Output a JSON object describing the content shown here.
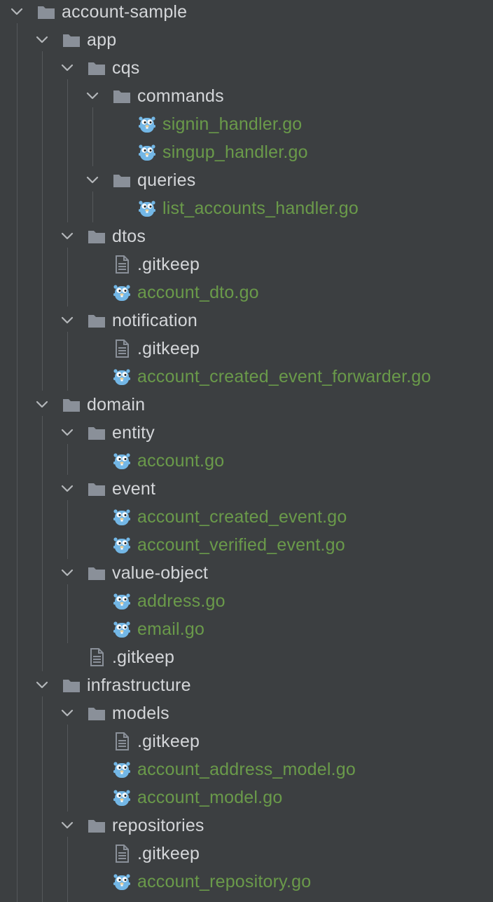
{
  "project_tree": {
    "items": [
      {
        "label": "account-sample",
        "kind": "folder",
        "depth": 0,
        "expanded": true,
        "icon": "folder-icon"
      },
      {
        "label": "app",
        "kind": "folder",
        "depth": 1,
        "expanded": true,
        "icon": "folder-icon"
      },
      {
        "label": "cqs",
        "kind": "folder",
        "depth": 2,
        "expanded": true,
        "icon": "folder-icon"
      },
      {
        "label": "commands",
        "kind": "folder",
        "depth": 3,
        "expanded": true,
        "icon": "folder-icon"
      },
      {
        "label": "signin_handler.go",
        "kind": "go",
        "depth": 4,
        "icon": "go-gopher-icon"
      },
      {
        "label": "singup_handler.go",
        "kind": "go",
        "depth": 4,
        "icon": "go-gopher-icon"
      },
      {
        "label": "queries",
        "kind": "folder",
        "depth": 3,
        "expanded": true,
        "icon": "folder-icon"
      },
      {
        "label": "list_accounts_handler.go",
        "kind": "go",
        "depth": 4,
        "icon": "go-gopher-icon"
      },
      {
        "label": "dtos",
        "kind": "folder",
        "depth": 2,
        "expanded": true,
        "icon": "folder-icon"
      },
      {
        "label": ".gitkeep",
        "kind": "file",
        "depth": 3,
        "icon": "text-file-icon"
      },
      {
        "label": "account_dto.go",
        "kind": "go",
        "depth": 3,
        "icon": "go-gopher-icon"
      },
      {
        "label": "notification",
        "kind": "folder",
        "depth": 2,
        "expanded": true,
        "icon": "folder-icon"
      },
      {
        "label": ".gitkeep",
        "kind": "file",
        "depth": 3,
        "icon": "text-file-icon"
      },
      {
        "label": "account_created_event_forwarder.go",
        "kind": "go",
        "depth": 3,
        "icon": "go-gopher-icon"
      },
      {
        "label": "domain",
        "kind": "folder",
        "depth": 1,
        "expanded": true,
        "icon": "folder-icon"
      },
      {
        "label": "entity",
        "kind": "folder",
        "depth": 2,
        "expanded": true,
        "icon": "folder-icon"
      },
      {
        "label": "account.go",
        "kind": "go",
        "depth": 3,
        "icon": "go-gopher-icon"
      },
      {
        "label": "event",
        "kind": "folder",
        "depth": 2,
        "expanded": true,
        "icon": "folder-icon"
      },
      {
        "label": "account_created_event.go",
        "kind": "go",
        "depth": 3,
        "icon": "go-gopher-icon"
      },
      {
        "label": "account_verified_event.go",
        "kind": "go",
        "depth": 3,
        "icon": "go-gopher-icon"
      },
      {
        "label": "value-object",
        "kind": "folder",
        "depth": 2,
        "expanded": true,
        "icon": "folder-icon"
      },
      {
        "label": "address.go",
        "kind": "go",
        "depth": 3,
        "icon": "go-gopher-icon"
      },
      {
        "label": "email.go",
        "kind": "go",
        "depth": 3,
        "icon": "go-gopher-icon"
      },
      {
        "label": ".gitkeep",
        "kind": "file",
        "depth": 2,
        "icon": "text-file-icon"
      },
      {
        "label": "infrastructure",
        "kind": "folder",
        "depth": 1,
        "expanded": true,
        "icon": "folder-icon"
      },
      {
        "label": "models",
        "kind": "folder",
        "depth": 2,
        "expanded": true,
        "icon": "folder-icon"
      },
      {
        "label": ".gitkeep",
        "kind": "file",
        "depth": 3,
        "icon": "text-file-icon"
      },
      {
        "label": "account_address_model.go",
        "kind": "go",
        "depth": 3,
        "icon": "go-gopher-icon"
      },
      {
        "label": "account_model.go",
        "kind": "go",
        "depth": 3,
        "icon": "go-gopher-icon"
      },
      {
        "label": "repositories",
        "kind": "folder",
        "depth": 2,
        "expanded": true,
        "icon": "folder-icon"
      },
      {
        "label": ".gitkeep",
        "kind": "file",
        "depth": 3,
        "icon": "text-file-icon"
      },
      {
        "label": "account_repository.go",
        "kind": "go",
        "depth": 3,
        "icon": "go-gopher-icon"
      }
    ]
  },
  "colors": {
    "background": "#3c3f41",
    "folder_text": "#d4d6d9",
    "go_file_text": "#6a9a4a",
    "folder_icon": "#8a9099",
    "go_gopher": "#73b7e6",
    "chevron": "#b4b7ba",
    "guide_line": "#55585b"
  }
}
